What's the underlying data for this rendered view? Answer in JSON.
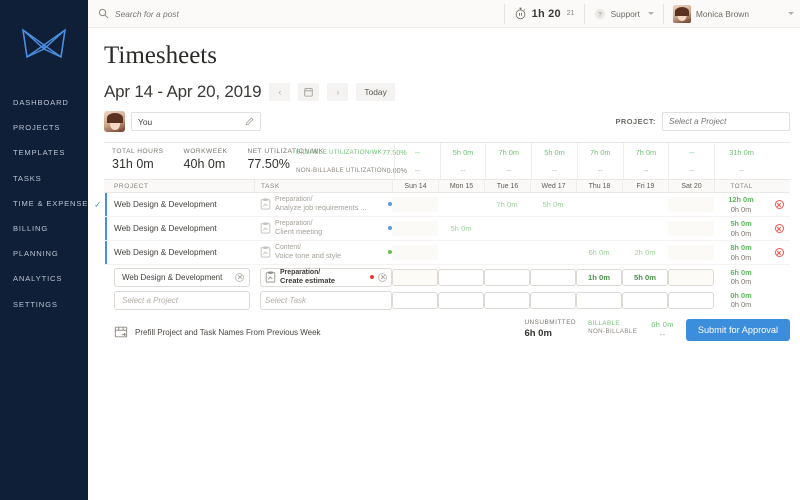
{
  "sidebar": {
    "logo_name": "butterfly-logo",
    "items": [
      {
        "label": "DASHBOARD"
      },
      {
        "label": "PROJECTS"
      },
      {
        "label": "TEMPLATES"
      },
      {
        "label": "TASKS"
      },
      {
        "label": "TIME & EXPENSE"
      },
      {
        "label": "BILLING"
      },
      {
        "label": "PLANNING"
      },
      {
        "label": "ANALYTICS"
      },
      {
        "label": "SETTINGS"
      }
    ]
  },
  "topbar": {
    "search_placeholder": "Search for a post",
    "timer_value": "1h 20",
    "timer_seconds": "21",
    "support_label": "Support",
    "user_name": "Monica Brown"
  },
  "page": {
    "title": "Timesheets",
    "date_range": "Apr 14 - Apr 20, 2019",
    "prev_label": "‹",
    "next_label": "›",
    "today_label": "Today",
    "user_field_value": "You",
    "project_filter_label": "PROJECT:",
    "project_filter_placeholder": "Select a Project"
  },
  "stats": {
    "total_hours_label": "TOTAL HOURS",
    "total_hours_value": "31h 0m",
    "workweek_label": "WORKWEEK",
    "workweek_value": "40h 0m",
    "net_util_label": "NET UTILIZATION/WK",
    "net_util_value": "77.50%",
    "billable_util_label": "BILLABLE UTILIZATION/WK",
    "billable_util_value": "77.50%",
    "nonbillable_util_label": "NON-BILLABLE UTILIZATION",
    "nonbillable_util_value": "0.00%",
    "day_totals_billable": [
      "--",
      "5h 0m",
      "7h 0m",
      "5h 0m",
      "7h 0m",
      "7h 0m",
      "--"
    ],
    "day_totals_nonbillable": [
      "--",
      "--",
      "--",
      "--",
      "--",
      "--",
      "--"
    ],
    "week_total_billable": "31h 0m",
    "week_total_nonbillable": "--"
  },
  "table": {
    "header": {
      "project": "PROJECT",
      "task": "TASK",
      "days": [
        "Sun 14",
        "Mon 15",
        "Tue 16",
        "Wed 17",
        "Thu 18",
        "Fri 19",
        "Sat 20"
      ],
      "total": "TOTAL"
    },
    "rows": [
      {
        "project": "Web Design & Development",
        "task_line1": "Preparation/",
        "task_line2": "Analyze job requirements ...",
        "dot_color": "#5a9bd8",
        "days": [
          "",
          "",
          "7h 0m",
          "5h 0m",
          "",
          "",
          ""
        ],
        "total_billable": "12h 0m",
        "total_nonbillable": "0h 0m",
        "editable": false,
        "deletable": true,
        "selected": true
      },
      {
        "project": "Web Design & Development",
        "task_line1": "Preparation/",
        "task_line2": "Client meeting",
        "dot_color": "#5a9bd8",
        "days": [
          "",
          "5h 0m",
          "",
          "",
          "",
          "",
          ""
        ],
        "total_billable": "5h 0m",
        "total_nonbillable": "0h 0m",
        "editable": false,
        "deletable": true,
        "selected": true
      },
      {
        "project": "Web Design & Development",
        "task_line1": "Content/",
        "task_line2": "Voice tone and style",
        "dot_color": "#6cbf5f",
        "days": [
          "",
          "",
          "",
          "",
          "6h 0m",
          "2h 0m",
          ""
        ],
        "total_billable": "8h 0m",
        "total_nonbillable": "0h 0m",
        "editable": false,
        "deletable": true,
        "selected": true
      },
      {
        "project": "Web Design & Development",
        "task_line1": "Preparation/",
        "task_line2": "Create estimate",
        "dot_color": "#e23b2e",
        "days": [
          "",
          "",
          "",
          "",
          "1h 0m",
          "5h 0m",
          ""
        ],
        "total_billable": "6h 0m",
        "total_nonbillable": "0h 0m",
        "editable": true,
        "deletable": false,
        "selected": false
      },
      {
        "project_placeholder": "Select a Project",
        "task_placeholder": "Select Task",
        "days": [
          "",
          "",
          "",
          "",
          "",
          "",
          ""
        ],
        "total_billable": "0h 0m",
        "total_nonbillable": "0h 0m",
        "editable": true,
        "blank": true,
        "deletable": false,
        "selected": false
      }
    ]
  },
  "footer": {
    "prefill_label": "Prefill Project and Task Names From Previous Week",
    "unsubmitted_label": "UNSUBMITTED",
    "unsubmitted_value": "6h 0m",
    "billable_label": "BILLABLE",
    "billable_value": "6h 0m",
    "nonbillable_label": "NON-BILLABLE",
    "nonbillable_value": "--",
    "submit_label": "Submit for Approval"
  },
  "colors": {
    "sidebar_bg": "#101f38",
    "accent_blue": "#3d8ddd",
    "green": "#72c174",
    "red": "#e8564d"
  }
}
